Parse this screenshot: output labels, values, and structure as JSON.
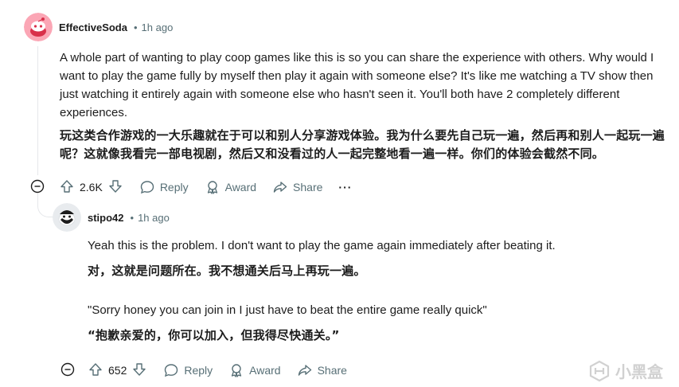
{
  "comments": [
    {
      "username": "EffectiveSoda",
      "separator": "•",
      "time": "1h ago",
      "text_en": "A whole part of wanting to play coop games like this is so you can share the experience with others. Why would I want to play the game fully by myself then play it again with someone else? It's like me watching a TV show then just watching it entirely again with someone else who hasn't seen it. You'll both have 2 completely different experiences.",
      "text_zh": "玩这类合作游戏的一大乐趣就在于可以和别人分享游戏体验。我为什么要先自己玩一遍，然后再和别人一起玩一遍呢？这就像我看完一部电视剧，然后又和没看过的人一起完整地看一遍一样。你们的体验会截然不同。",
      "votes": "2.6K",
      "reply_label": "Reply",
      "award_label": "Award",
      "share_label": "Share",
      "more_label": "···"
    },
    {
      "username": "stipo42",
      "separator": "•",
      "time": "1h ago",
      "text_en_1": "Yeah this is the problem. I don't want to play the game again immediately after beating it.",
      "text_zh_1": "对，这就是问题所在。我不想通关后马上再玩一遍。",
      "text_en_2": "\"Sorry honey you can join in I just have to beat the entire game really quick\"",
      "text_zh_2": "“抱歉亲爱的，你可以加入，但我得尽快通关。”",
      "votes": "652",
      "reply_label": "Reply",
      "award_label": "Award",
      "share_label": "Share",
      "more_label": "···"
    }
  ],
  "watermark": "小黑盒"
}
